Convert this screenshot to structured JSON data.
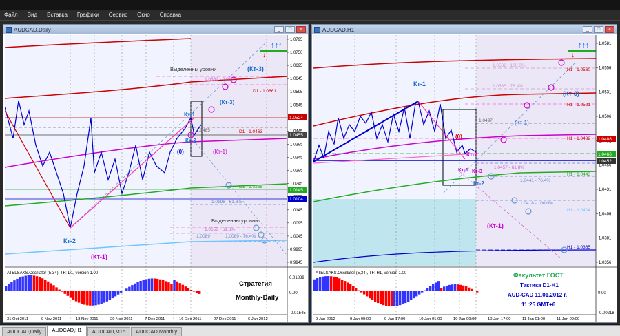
{
  "menu": [
    "Файл",
    "Вид",
    "Вставка",
    "Графики",
    "Сервис",
    "Окно",
    "Справка"
  ],
  "tabs": [
    {
      "label": "AUDCAD,Daily",
      "active": false
    },
    {
      "label": "AUDCAD,H1",
      "active": true
    },
    {
      "label": "AUDCAD,M15",
      "active": false
    },
    {
      "label": "AUDCAD,Monthly",
      "active": false
    }
  ],
  "window_buttons": {
    "minimize": "_",
    "maximize": "□",
    "close": "×"
  },
  "daily": {
    "title": "AUDCAD,Daily",
    "price_ticks": [
      "1.0795",
      "1.0750",
      "1.0695",
      "1.0645",
      "1.0595",
      "1.0545",
      "1.0495",
      "1.0445",
      "1.0395",
      "1.0345",
      "1.0295",
      "1.0245",
      "1.0195",
      "1.0145",
      "1.0095",
      "1.0045",
      "0.9995",
      "0.9945"
    ],
    "price_tags": {
      "red": "1.0524",
      "dark": "1.0455",
      "green": "1.0145",
      "blue": "1.0104"
    },
    "labels": {
      "vydelennye_top": "Выделенны уровни",
      "vydelennye_bottom": "Выделенны уровни",
      "kt3_a": "(Кт-3)",
      "kt3_b": "(Кт-3)",
      "kt1": "Кт-1",
      "kt2_right": "Кт-2",
      "kt1_paren": "(Кт-1)",
      "zero": "(0)",
      "kt2_left": "Кт-2",
      "kt1_bottom": "(Кт-1)"
    },
    "levels": {
      "d1_1": "D1 - 1.0661",
      "d1_2": "D1 - 1.0463",
      "d1_3": "D1 - 1.0265",
      "l1": "1.0485",
      "l2": "1.0198 - 61.8%",
      "l3": "1.0089",
      "l4": "1.0089 - 76.4%",
      "l5": "1.0882 - 0.0%",
      "l6": "1.0658 - 61.8%"
    },
    "osc": {
      "name": "ATELSAKS.Oscillator (5,34), TF: D1, version 1.00",
      "ticks": [
        "0.01889",
        "0.00",
        "-0.01545"
      ]
    },
    "strategy": {
      "line1": "Стратегия",
      "line2": "Monthly-Daily"
    },
    "dates": [
      "31 Oct 2011",
      "9 Nov 2011",
      "18 Nov 2011",
      "29 Nov 2011",
      "7 Dec 2011",
      "16 Dec 2011",
      "27 Dec 2011",
      "6 Jan 2012"
    ]
  },
  "h1": {
    "title": "AUDCAD,H1",
    "price_ticks": [
      "1.0581",
      "1.0556",
      "1.0531",
      "1.0506",
      "1.0481",
      "1.0456",
      "1.0431",
      "1.0406",
      "1.0381",
      "1.0356"
    ],
    "price_tags": {
      "red": "1.0488",
      "green": "1.0466",
      "dark": "1.0452"
    },
    "labels": {
      "kt1_top": "Кт-1",
      "kt3": "(Кт-3)",
      "kt1_paren": "(Кт-1)",
      "zero": "(0)",
      "kt2": "Кт-2",
      "kt1_small": "Кт-1",
      "kt3_small": "Кт-3",
      "kt2_low": "Кт-2",
      "kt1_bottom": "(Кт-1)"
    },
    "levels": {
      "h1_1": "H1 - 1.0560",
      "h1_2": "H1 - 1.0521",
      "h1_3": "H1 - 1.0482",
      "h1_4": "H1 - 1.0443",
      "h1_5": "H1 - 1.0404",
      "h1_6": "H1 - 1.0365",
      "l1": "1.0582 - 100.0%",
      "l2": "1.0535 - 76.4%",
      "l3": "1.0497",
      "l4": "1.0457 - 61.8%",
      "l5": "1.0441 - 76.4%",
      "l6": "1.0418 - 100.0%"
    },
    "osc": {
      "name": "ATELSAKS.Oscillator (5,34), TF: H1, version 1.00",
      "ticks": [
        "0.00",
        "-0.00218"
      ]
    },
    "info": {
      "line1": "Факультет ГОСТ",
      "line2": "Тактика  D1-H1",
      "line3": "AUD-CAD 11.01.2012 г.",
      "line4": "11:25   GMT+6"
    },
    "dates": [
      "9 Jan 2012",
      "9 Jan 09:00",
      "9 Jan 17:00",
      "10 Jan 01:00",
      "10 Jan 09:00",
      "10 Jan 17:00",
      "11 Jan 01:00",
      "11 Jan 09:00"
    ]
  },
  "colors": {
    "bg": "#ffffff",
    "price_line": "#0000cc",
    "support": "#ff00ff",
    "resistance": "#cc0000",
    "ma_green": "#22aa22",
    "ma_cyan": "#6ec6ff",
    "osc_red": "#ff0000",
    "osc_blue": "#3333ff"
  }
}
